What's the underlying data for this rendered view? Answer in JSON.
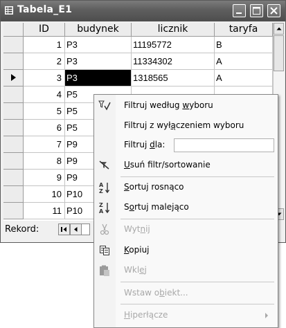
{
  "window": {
    "title": "Tabela_E1"
  },
  "table": {
    "columns": [
      "ID",
      "budynek",
      "licznik",
      "taryfa"
    ],
    "rows": [
      {
        "id": "1",
        "budynek": "P3",
        "licznik": "11195772",
        "taryfa": "B"
      },
      {
        "id": "2",
        "budynek": "P3",
        "licznik": "11334302",
        "taryfa": "A"
      },
      {
        "id": "3",
        "budynek": "P3",
        "licznik": "1318565",
        "taryfa": "A"
      },
      {
        "id": "4",
        "budynek": "P5",
        "licznik": "",
        "taryfa": ""
      },
      {
        "id": "5",
        "budynek": "P5",
        "licznik": "",
        "taryfa": ""
      },
      {
        "id": "6",
        "budynek": "P5",
        "licznik": "",
        "taryfa": ""
      },
      {
        "id": "7",
        "budynek": "P9",
        "licznik": "",
        "taryfa": ""
      },
      {
        "id": "8",
        "budynek": "P9",
        "licznik": "",
        "taryfa": ""
      },
      {
        "id": "9",
        "budynek": "P9",
        "licznik": "",
        "taryfa": ""
      },
      {
        "id": "10",
        "budynek": "P10",
        "licznik": "",
        "taryfa": ""
      },
      {
        "id": "11",
        "budynek": "P10",
        "licznik": "",
        "taryfa": ""
      }
    ],
    "current_row_index": 2
  },
  "navbar": {
    "label": "Rekord:"
  },
  "context_menu": {
    "filter_by_selection": {
      "pre": "Filtruj według ",
      "u": "w",
      "post": "yboru"
    },
    "filter_excluding": {
      "pre": "Filtruj z wył",
      "u": "ą",
      "post": "czeniem wyboru"
    },
    "filter_for": {
      "pre": "Filtruj ",
      "u": "d",
      "post": "la:"
    },
    "remove_filter": {
      "pre": "",
      "u": "U",
      "post": "suń filtr/sortowanie"
    },
    "sort_asc": {
      "pre": "",
      "u": "S",
      "post": "ortuj rosnąco"
    },
    "sort_desc": {
      "pre": "S",
      "u": "o",
      "post": "rtuj malejąco"
    },
    "cut": {
      "pre": "Wyt",
      "u": "n",
      "post": "ij"
    },
    "copy": {
      "pre": "",
      "u": "K",
      "post": "opiuj"
    },
    "paste": {
      "pre": "Wkl",
      "u": "e",
      "post": "j"
    },
    "insert_object": {
      "pre": "Wstaw o",
      "u": "b",
      "post": "iekt..."
    },
    "hyperlink": {
      "pre": "",
      "u": "H",
      "post": "iperłącze"
    }
  },
  "icons": {
    "app": "datasheet-icon",
    "minimize": "minimize-icon",
    "maximize": "maximize-icon",
    "close": "close-icon",
    "record_pointer": "row-pointer-icon",
    "filter_selection": "filter-selection-icon",
    "remove_filter": "remove-filter-icon",
    "sort_asc": "sort-ascending-icon",
    "sort_desc": "sort-descending-icon",
    "cut": "scissors-icon",
    "copy": "copy-icon",
    "paste": "paste-icon",
    "submenu": "submenu-arrow-icon"
  },
  "colors": {
    "titlebar": "#5e5e5e",
    "selection": "#000000",
    "menu_bg": "#f9f9f9",
    "disabled_text": "#a8a8a8"
  }
}
